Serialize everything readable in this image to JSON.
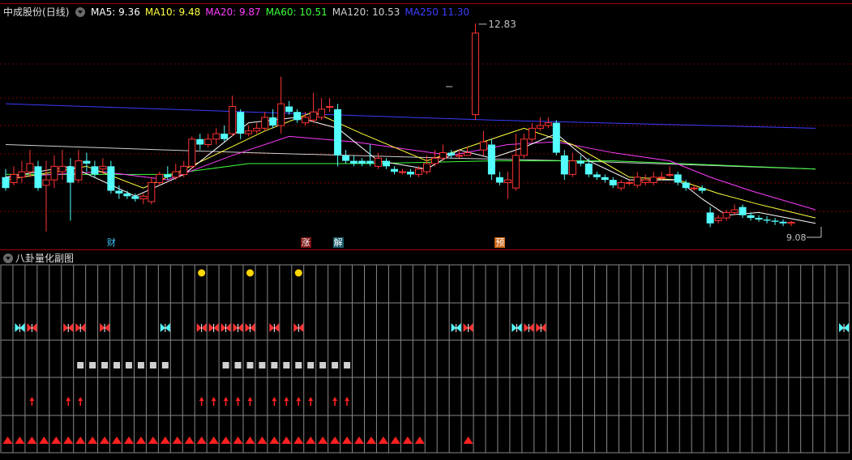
{
  "stock": {
    "name": "中成股份",
    "period": "(日线)"
  },
  "ma_legend": [
    {
      "label": "MA5:",
      "value": "9.36",
      "color": "#ffffff"
    },
    {
      "label": "MA10:",
      "value": "9.48",
      "color": "#ffff3c"
    },
    {
      "label": "MA20:",
      "value": "9.87",
      "color": "#ff3cff"
    },
    {
      "label": "MA60:",
      "value": "10.51",
      "color": "#3cff3c"
    },
    {
      "label": "MA120:",
      "value": "10.53",
      "color": "#d0d0d0"
    },
    {
      "label": "MA250",
      "value": "11.30",
      "color": "#3c3cff"
    }
  ],
  "annotations": {
    "high": "12.83",
    "low": "9.08"
  },
  "event_tags": [
    {
      "text": "财",
      "bg": "#000000",
      "fg": "#3cc8ff"
    },
    {
      "text": "涨",
      "bg": "#7a1010",
      "fg": "#ffffff"
    },
    {
      "text": "解",
      "bg": "#1a5a6a",
      "fg": "#ffffff"
    },
    {
      "text": "预",
      "bg": "#c86414",
      "fg": "#ffffff"
    }
  ],
  "sub_chart": {
    "title": "八卦量化副图"
  },
  "colors": {
    "up": "#ff3333",
    "down": "#54ffff",
    "grid": "#7a0000",
    "sub_grid": "#888888"
  },
  "icons": {
    "collapse": "chevron-down-icon",
    "butterfly": "butterfly-icon",
    "arrow": "up-arrow-icon",
    "dot": "yellow-dot-icon",
    "square": "gray-square-icon",
    "triangle": "red-triangle-icon"
  },
  "chart_data": {
    "type": "candlestick",
    "price_range": [
      8.7,
      13.2
    ],
    "candles": [
      [
        10.0,
        9.8,
        10.15,
        9.75
      ],
      [
        9.9,
        10.05,
        10.2,
        9.85
      ],
      [
        10.0,
        10.1,
        10.3,
        9.9
      ],
      [
        10.1,
        10.25,
        10.5,
        10.0
      ],
      [
        10.2,
        9.8,
        10.3,
        9.75
      ],
      [
        9.85,
        9.95,
        10.3,
        9.0
      ],
      [
        9.95,
        10.2,
        10.4,
        9.8
      ],
      [
        10.1,
        10.2,
        10.5,
        9.95
      ],
      [
        10.2,
        9.9,
        10.35,
        9.2
      ],
      [
        9.95,
        10.3,
        10.5,
        9.9
      ],
      [
        10.3,
        10.25,
        10.45,
        10.1
      ],
      [
        10.2,
        10.05,
        10.3,
        10.0
      ],
      [
        10.15,
        10.2,
        10.35,
        10.05
      ],
      [
        10.2,
        9.75,
        10.3,
        9.7
      ],
      [
        9.75,
        9.7,
        9.85,
        9.6
      ],
      [
        9.7,
        9.65,
        9.75,
        9.6
      ],
      [
        9.65,
        9.6,
        9.7,
        9.55
      ],
      [
        9.6,
        9.65,
        9.7,
        9.5
      ],
      [
        9.55,
        9.9,
        10.0,
        9.5
      ],
      [
        9.9,
        10.05,
        10.1,
        9.85
      ],
      [
        10.05,
        10.0,
        10.2,
        9.95
      ],
      [
        10.0,
        10.1,
        10.25,
        9.95
      ],
      [
        10.05,
        10.2,
        10.3,
        10.0
      ],
      [
        10.2,
        10.7,
        10.75,
        10.15
      ],
      [
        10.7,
        10.6,
        10.8,
        10.5
      ],
      [
        10.6,
        10.7,
        10.8,
        10.55
      ],
      [
        10.7,
        10.8,
        10.9,
        10.6
      ],
      [
        10.8,
        10.7,
        10.95,
        10.65
      ],
      [
        10.8,
        11.3,
        11.5,
        10.75
      ],
      [
        11.2,
        10.8,
        11.25,
        10.7
      ],
      [
        10.8,
        10.85,
        10.95,
        10.75
      ],
      [
        10.85,
        10.9,
        11.0,
        10.8
      ],
      [
        10.9,
        11.1,
        11.2,
        10.85
      ],
      [
        11.1,
        10.95,
        11.25,
        10.9
      ],
      [
        10.95,
        11.35,
        11.85,
        10.8
      ],
      [
        11.3,
        11.2,
        11.4,
        11.15
      ],
      [
        11.2,
        11.05,
        11.25,
        11.0
      ],
      [
        11.0,
        11.1,
        11.2,
        10.95
      ],
      [
        11.05,
        11.2,
        11.55,
        11.0
      ],
      [
        11.1,
        11.25,
        11.45,
        11.05
      ],
      [
        11.3,
        11.3,
        11.45,
        11.2
      ],
      [
        11.25,
        10.4,
        11.35,
        10.2
      ],
      [
        10.4,
        10.3,
        10.5,
        10.25
      ],
      [
        10.3,
        10.25,
        10.4,
        10.2
      ],
      [
        10.3,
        10.25,
        10.35,
        10.2
      ],
      [
        10.3,
        10.25,
        10.6,
        10.2
      ],
      [
        10.2,
        10.35,
        10.45,
        10.15
      ],
      [
        10.3,
        10.2,
        10.35,
        10.15
      ],
      [
        10.15,
        10.1,
        10.2,
        10.05
      ],
      [
        10.1,
        10.1,
        10.15,
        10.05
      ],
      [
        10.1,
        10.05,
        10.15,
        10.0
      ],
      [
        10.05,
        10.15,
        10.2,
        10.0
      ],
      [
        10.1,
        10.25,
        10.4,
        10.05
      ],
      [
        10.25,
        10.35,
        10.5,
        10.2
      ],
      [
        10.35,
        10.45,
        10.6,
        10.3
      ],
      [
        10.45,
        10.4,
        10.5,
        10.35
      ],
      [
        10.4,
        10.4,
        10.5,
        10.35
      ],
      [
        10.4,
        10.45,
        10.55,
        10.4
      ],
      [
        11.15,
        12.65,
        12.83,
        11.05
      ],
      [
        10.5,
        10.65,
        10.85,
        10.4
      ],
      [
        10.6,
        10.05,
        10.7,
        9.95
      ],
      [
        10.0,
        9.9,
        10.1,
        9.85
      ],
      [
        9.9,
        9.95,
        10.1,
        9.6
      ],
      [
        9.8,
        10.4,
        10.8,
        9.75
      ],
      [
        10.4,
        10.7,
        10.8,
        10.35
      ],
      [
        10.7,
        10.9,
        11.0,
        10.65
      ],
      [
        10.9,
        10.95,
        11.1,
        10.85
      ],
      [
        10.95,
        11.0,
        11.1,
        10.9
      ],
      [
        11.0,
        10.45,
        11.05,
        10.4
      ],
      [
        10.4,
        10.05,
        10.5,
        9.95
      ],
      [
        10.05,
        10.3,
        10.45,
        10.0
      ],
      [
        10.3,
        10.25,
        10.4,
        10.2
      ],
      [
        10.25,
        10.05,
        10.35,
        10.0
      ],
      [
        10.05,
        10.0,
        10.1,
        9.95
      ],
      [
        10.0,
        9.95,
        10.05,
        9.9
      ],
      [
        9.95,
        9.85,
        10.0,
        9.8
      ],
      [
        9.8,
        9.9,
        9.95,
        9.75
      ],
      [
        9.9,
        9.9,
        9.95,
        9.85
      ],
      [
        9.85,
        10.0,
        10.1,
        9.8
      ],
      [
        9.9,
        9.95,
        10.05,
        9.85
      ],
      [
        9.9,
        10.0,
        10.1,
        9.85
      ],
      [
        10.0,
        10.0,
        10.1,
        9.95
      ],
      [
        10.05,
        10.05,
        10.2,
        10.0
      ],
      [
        10.05,
        9.9,
        10.1,
        9.85
      ],
      [
        9.9,
        9.8,
        9.95,
        9.75
      ],
      [
        9.8,
        9.8,
        9.85,
        9.75
      ],
      [
        9.8,
        9.75,
        9.85,
        9.7
      ],
      [
        9.35,
        9.15,
        9.45,
        9.08
      ],
      [
        9.2,
        9.25,
        9.3,
        9.15
      ],
      [
        9.25,
        9.35,
        9.4,
        9.2
      ],
      [
        9.35,
        9.4,
        9.5,
        9.3
      ],
      [
        9.45,
        9.3,
        9.5,
        9.25
      ],
      [
        9.3,
        9.25,
        9.35,
        9.2
      ],
      [
        9.25,
        9.22,
        9.3,
        9.18
      ],
      [
        9.22,
        9.2,
        9.28,
        9.15
      ],
      [
        9.2,
        9.18,
        9.25,
        9.12
      ],
      [
        9.18,
        9.15,
        9.22,
        9.1
      ],
      [
        9.15,
        9.17,
        9.2,
        9.1
      ]
    ],
    "ma250": [
      [
        0,
        11.35
      ],
      [
        60,
        11.05
      ],
      [
        100,
        10.9
      ]
    ],
    "ma120": [
      [
        0,
        10.6
      ],
      [
        30,
        10.45
      ],
      [
        55,
        10.35
      ],
      [
        70,
        10.3
      ],
      [
        100,
        10.15
      ]
    ],
    "ma60": [
      [
        0,
        10.05
      ],
      [
        20,
        10.05
      ],
      [
        30,
        10.25
      ],
      [
        45,
        10.25
      ],
      [
        60,
        10.3
      ],
      [
        75,
        10.3
      ],
      [
        100,
        10.15
      ]
    ],
    "ma20": [
      [
        0,
        10.0
      ],
      [
        12,
        10.1
      ],
      [
        20,
        9.95
      ],
      [
        28,
        10.4
      ],
      [
        35,
        10.75
      ],
      [
        43,
        10.65
      ],
      [
        55,
        10.4
      ],
      [
        62,
        10.6
      ],
      [
        68,
        10.65
      ],
      [
        75,
        10.45
      ],
      [
        82,
        10.3
      ],
      [
        87,
        10.0
      ],
      [
        92,
        9.75
      ],
      [
        100,
        9.4
      ]
    ],
    "ma10": [
      [
        0,
        9.95
      ],
      [
        10,
        10.2
      ],
      [
        17,
        9.8
      ],
      [
        25,
        10.35
      ],
      [
        32,
        10.85
      ],
      [
        38,
        11.2
      ],
      [
        44,
        10.8
      ],
      [
        52,
        10.3
      ],
      [
        59,
        10.65
      ],
      [
        64,
        10.9
      ],
      [
        70,
        10.6
      ],
      [
        77,
        10.0
      ],
      [
        83,
        9.95
      ],
      [
        88,
        9.7
      ],
      [
        93,
        9.5
      ],
      [
        100,
        9.25
      ]
    ],
    "ma5": [
      [
        0,
        10.0
      ],
      [
        8,
        10.2
      ],
      [
        16,
        9.65
      ],
      [
        22,
        10.05
      ],
      [
        30,
        11.0
      ],
      [
        36,
        11.1
      ],
      [
        41,
        10.9
      ],
      [
        46,
        10.3
      ],
      [
        52,
        10.15
      ],
      [
        56,
        10.5
      ],
      [
        60,
        10.35
      ],
      [
        64,
        10.55
      ],
      [
        68,
        10.8
      ],
      [
        72,
        10.3
      ],
      [
        77,
        9.95
      ],
      [
        83,
        9.95
      ],
      [
        86,
        9.6
      ],
      [
        89,
        9.3
      ],
      [
        93,
        9.35
      ],
      [
        100,
        9.15
      ]
    ],
    "tag_positions": [
      13,
      37,
      41,
      61
    ],
    "sub_series": {
      "dots": [
        16,
        20,
        24
      ],
      "butterflies": [
        [
          1,
          "cyan"
        ],
        [
          2,
          "red"
        ],
        [
          5,
          "red"
        ],
        [
          6,
          "red"
        ],
        [
          8,
          "red"
        ],
        [
          13,
          "cyan"
        ],
        [
          16,
          "red"
        ],
        [
          17,
          "red"
        ],
        [
          18,
          "red"
        ],
        [
          19,
          "red"
        ],
        [
          20,
          "red"
        ],
        [
          22,
          "red"
        ],
        [
          24,
          "red"
        ],
        [
          37,
          "cyan"
        ],
        [
          38,
          "red"
        ],
        [
          42,
          "cyan"
        ],
        [
          43,
          "red"
        ],
        [
          44,
          "red"
        ],
        [
          69,
          "cyan"
        ]
      ],
      "squares": [
        6,
        7,
        8,
        9,
        10,
        11,
        12,
        13,
        18,
        19,
        20,
        21,
        22,
        23,
        24,
        25,
        26,
        27,
        28
      ],
      "arrows": [
        2,
        5,
        6,
        16,
        17,
        18,
        19,
        20,
        22,
        23,
        24,
        25,
        27,
        28
      ],
      "triangles": [
        0,
        1,
        2,
        3,
        4,
        5,
        6,
        7,
        8,
        9,
        10,
        11,
        12,
        13,
        14,
        15,
        16,
        17,
        18,
        19,
        20,
        21,
        22,
        23,
        24,
        25,
        26,
        27,
        28,
        29,
        30,
        31,
        32,
        33,
        34,
        38
      ]
    }
  }
}
